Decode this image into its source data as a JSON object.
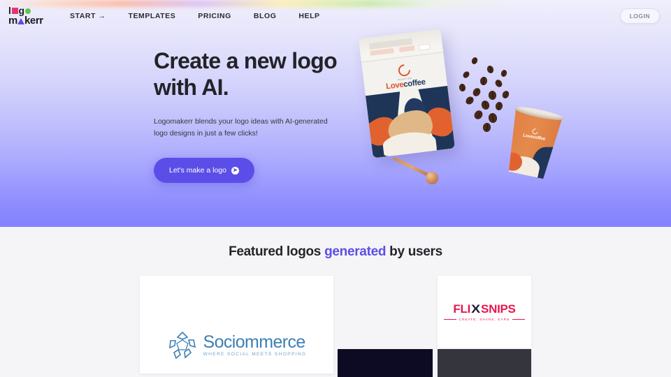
{
  "brand": {
    "line1_pre": "l",
    "line1_mid": "g",
    "line1_post": "",
    "line2_pre": "m",
    "line2_post": "kerr",
    "full_name": "logomakerr",
    "colors": {
      "square": "#e8356d",
      "circle": "#5fc44a",
      "triangle": "#5b4fe0"
    }
  },
  "nav": {
    "items": [
      {
        "label": "START →"
      },
      {
        "label": "TEMPLATES"
      },
      {
        "label": "PRICING"
      },
      {
        "label": "BLOG"
      },
      {
        "label": "HELP"
      }
    ],
    "login_label": "LOGIN"
  },
  "hero": {
    "title_line1": "Create a new logo",
    "title_line2": "with AI.",
    "subtitle": "Logomakerr blends your logo ideas with AI-generated logo designs in just a few clicks!",
    "cta_label": "Let's make a logo",
    "cta_icon": "arrow-right-circle-icon",
    "accent_color": "#5b4ee8",
    "art": {
      "product_name": "coffee packaging mockup",
      "bag_brand_part1": "Love",
      "bag_brand_part2": "coffee",
      "bag_tiny_text": "ROASTED",
      "cup_brand": "Lovecoffee"
    }
  },
  "featured": {
    "title_part1": "Featured logos ",
    "title_highlight": "generated",
    "title_part2": " by users",
    "highlight_color": "#5b4ee8",
    "cards": [
      {
        "id": "sociommerce",
        "name": "Sociommerce",
        "tagline": "WHERE SOCIAL MEETS SHOPPING",
        "color": "#3d7fb5"
      },
      {
        "id": "flixsnips",
        "name_part1": "FLI",
        "name_x": "X",
        "name_part2": "SNIPS",
        "tagline": "CREATE, SHARE, EARN",
        "color": "#e8174f"
      },
      {
        "id": "dark-card-1",
        "bg": "#0d0a24"
      },
      {
        "id": "dark-card-2",
        "bg": "#35353e"
      }
    ]
  }
}
